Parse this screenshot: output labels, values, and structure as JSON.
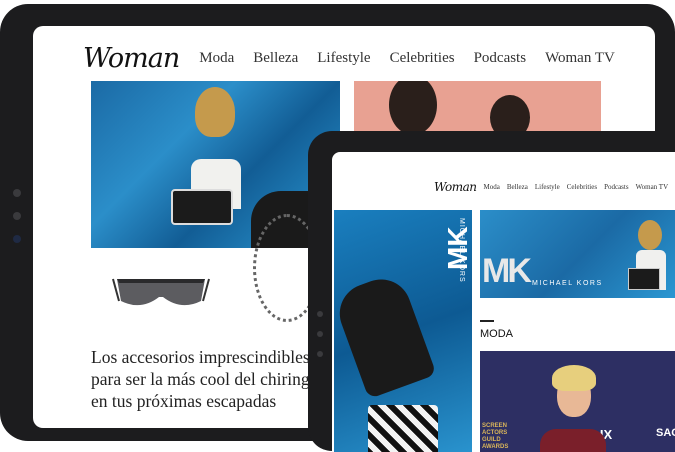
{
  "back_screen": {
    "logo": "Woman",
    "nav": [
      "Moda",
      "Belleza",
      "Lifestyle",
      "Celebrities",
      "Podcasts",
      "Woman TV"
    ],
    "article_title": "Los accesorios imprescindibles para ser la más cool del chiringuito en tus próximas escapadas"
  },
  "front_screen": {
    "logo": "Woman",
    "nav": [
      "Moda",
      "Belleza",
      "Lifestyle",
      "Celebrities",
      "Podcasts",
      "Woman TV"
    ],
    "ad_brand_vertical": "MICHAEL KORS",
    "ad_monogram": "MK",
    "ad_brand": "MICHAEL KORS",
    "section_title": "MODA",
    "photo_backdrop_text": [
      "SCREEN",
      "ACTORS",
      "GUILD",
      "AWARDS"
    ],
    "photo_backdrop_logo": "FLIX",
    "photo_backdrop_right": "SAG"
  }
}
